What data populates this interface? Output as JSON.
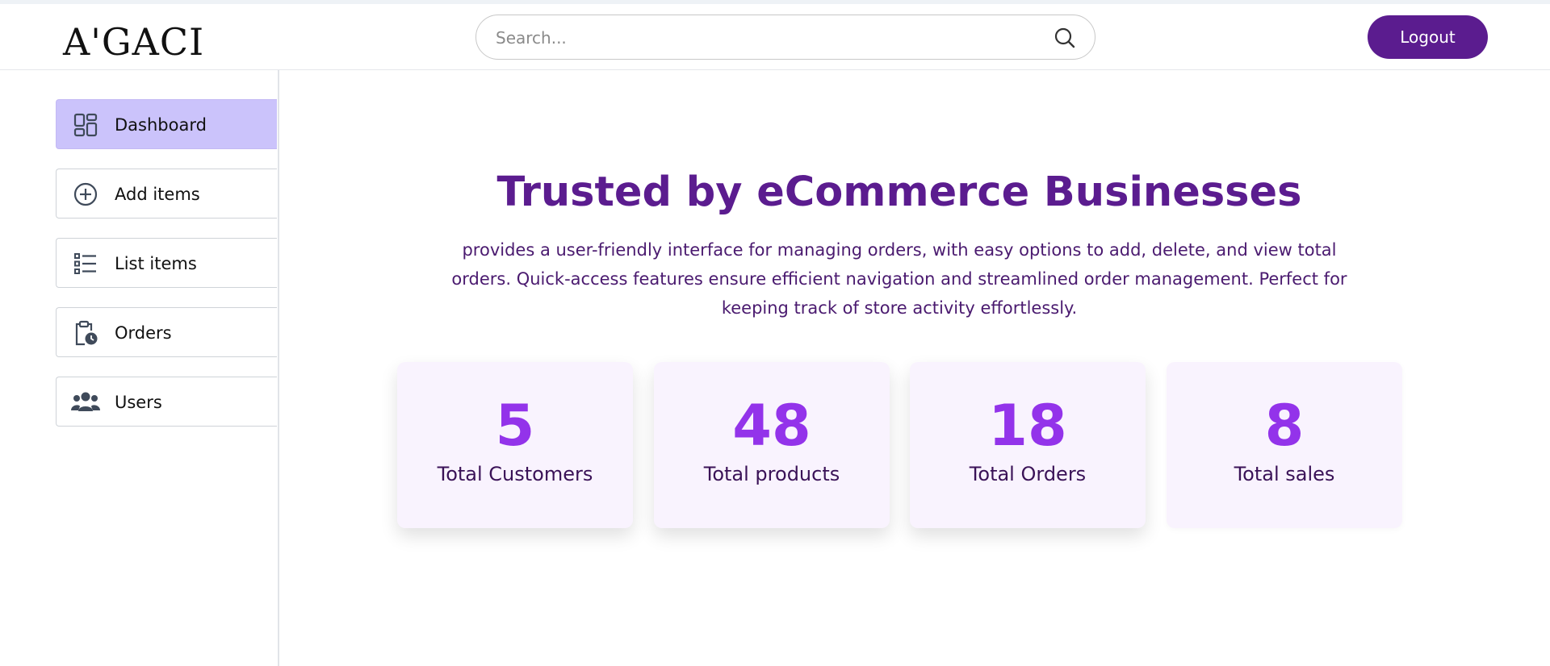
{
  "header": {
    "logo_text": "A'GACI",
    "search_placeholder": "Search...",
    "search_value": "",
    "logout_label": "Logout"
  },
  "sidebar": {
    "items": [
      {
        "label": "Dashboard",
        "icon": "dashboard-icon",
        "active": true
      },
      {
        "label": "Add items",
        "icon": "add-circle-icon",
        "active": false
      },
      {
        "label": "List items",
        "icon": "list-icon",
        "active": false
      },
      {
        "label": "Orders",
        "icon": "clipboard-clock-icon",
        "active": false
      },
      {
        "label": "Users",
        "icon": "users-icon",
        "active": false
      }
    ]
  },
  "hero": {
    "title": "Trusted by eCommerce Businesses",
    "description": "provides a user-friendly interface for managing orders, with easy options to add, delete, and view total orders. Quick-access features ensure efficient navigation and streamlined order management. Perfect for keeping track of store activity effortlessly."
  },
  "stats": [
    {
      "value": "5",
      "label": "Total Customers"
    },
    {
      "value": "48",
      "label": "Total products"
    },
    {
      "value": "18",
      "label": "Total Orders"
    },
    {
      "value": "8",
      "label": "Total sales"
    }
  ],
  "colors": {
    "brand": "#5b1c8f",
    "accent": "#9333ea",
    "active_nav": "#cbc3fb",
    "card_bg": "#f9f3fe"
  }
}
